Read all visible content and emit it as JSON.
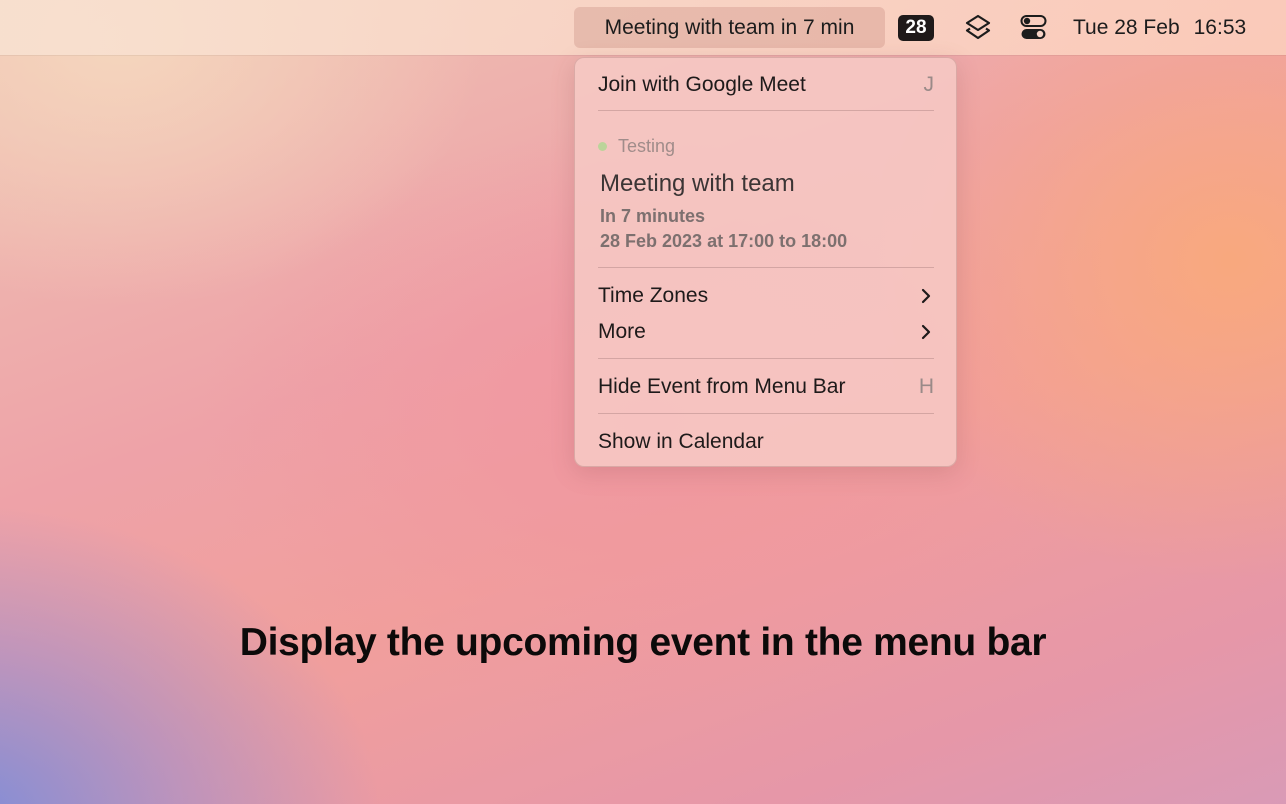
{
  "menubar": {
    "event_status": "Meeting with team in 7 min",
    "calendar_day_badge": "28",
    "icons": [
      "layers-icon",
      "control-center-icon"
    ],
    "date": "Tue 28 Feb",
    "time": "16:53"
  },
  "menu": {
    "join_label": "Join with Google Meet",
    "join_shortcut": "J",
    "calendar_name": "Testing",
    "calendar_color": "#bcd49a",
    "event_title": "Meeting with team",
    "event_relative": "In 7 minutes",
    "event_range": "28 Feb 2023 at 17:00 to 18:00",
    "time_zones_label": "Time Zones",
    "more_label": "More",
    "hide_label": "Hide Event from Menu Bar",
    "hide_shortcut": "H",
    "show_calendar_label": "Show in Calendar"
  },
  "caption": "Display the upcoming event in the menu bar"
}
